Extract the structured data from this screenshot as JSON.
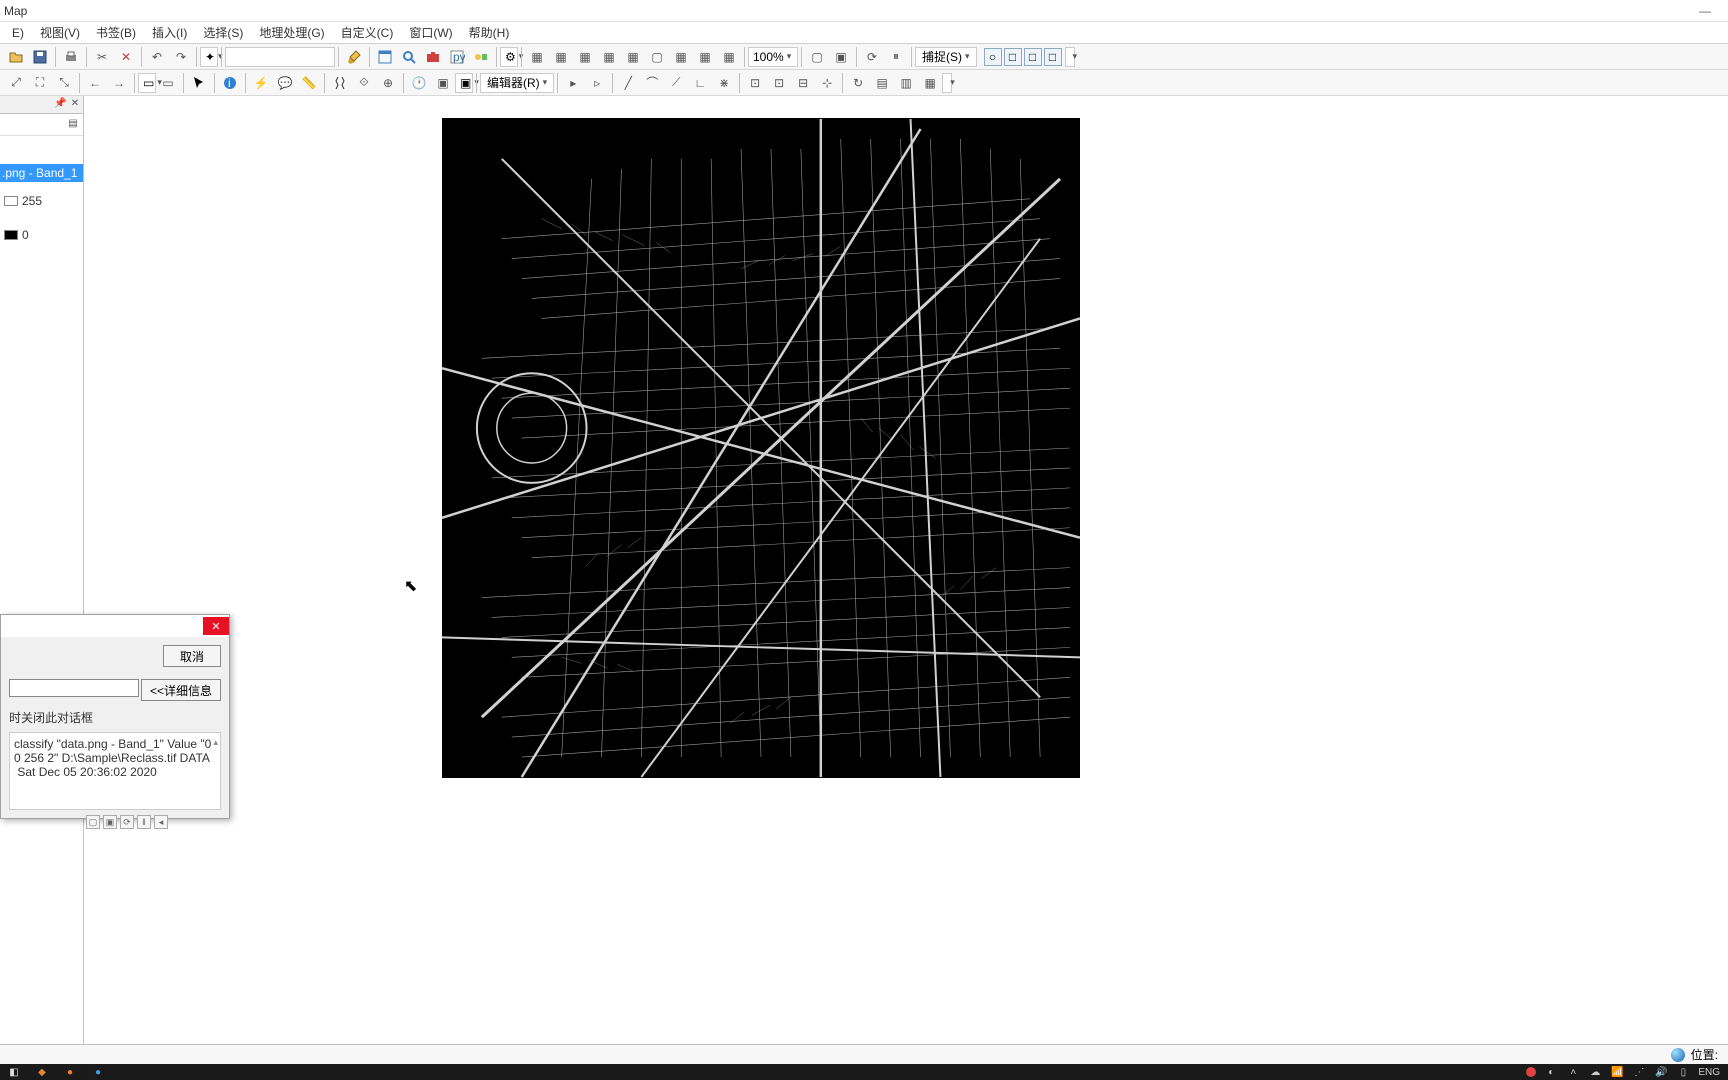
{
  "title_suffix": "Map",
  "menu": {
    "file": "E)",
    "view": "视图(V)",
    "bookmarks": "书签(B)",
    "insert": "插入(I)",
    "selection": "选择(S)",
    "geoprocessing": "地理处理(G)",
    "customize": "自定义(C)",
    "windows": "窗口(W)",
    "help": "帮助(H)"
  },
  "toolbar1": {
    "zoom_pct": "100%",
    "snap_label": "捕捉(S)"
  },
  "toolbar2": {
    "editor_label": "编辑器(R)"
  },
  "toc": {
    "layer_name": ".png - Band_1",
    "val_hi": "255",
    "val_lo": "0"
  },
  "dialog": {
    "cancel": "取消",
    "details": "<<详细信息",
    "close_after": "时关闭此对话框",
    "log_line1": "classify \"data.png - Band_1\" Value \"0",
    "log_line2": "0 256 2\" D:\\Sample\\Reclass.tif DATA",
    "log_line3": " Sat Dec 05 20:36:02 2020"
  },
  "statusbar": {
    "position_label": "位置:"
  },
  "taskbar": {
    "lang": "ENG"
  }
}
